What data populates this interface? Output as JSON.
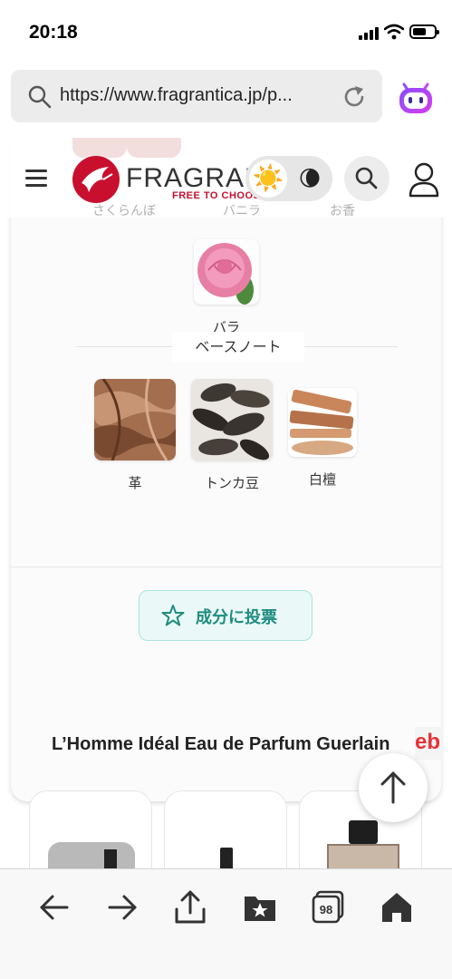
{
  "status_bar": {
    "time": "20:18"
  },
  "browser": {
    "url": "https://www.fragrantica.jp/p...",
    "tab_count": "98"
  },
  "site": {
    "logo_text": "FRAGRANTICA",
    "tagline": "FREE TO CHOOSE",
    "theme_light_icon": "☀️",
    "theme_dark_icon": "🌘"
  },
  "notes": {
    "ghost_labels": [
      "さくらんぼ",
      "バニラ",
      "お香"
    ],
    "middle": [
      {
        "label": "バラ",
        "icon": "rose"
      }
    ],
    "base_title": "ベースノート",
    "base": [
      {
        "label": "革",
        "icon": "leather"
      },
      {
        "label": "トンカ豆",
        "icon": "tonka-bean"
      },
      {
        "label": "白檀",
        "icon": "sandalwood"
      }
    ]
  },
  "vote_button": {
    "label": "成分に投票"
  },
  "perfume": {
    "title": "L’Homme Idéal Eau de Parfum Guerlain"
  },
  "ad": {
    "logo_text": "eb"
  },
  "colors": {
    "brand": "#c8102e",
    "accent": "#1f8c80"
  }
}
